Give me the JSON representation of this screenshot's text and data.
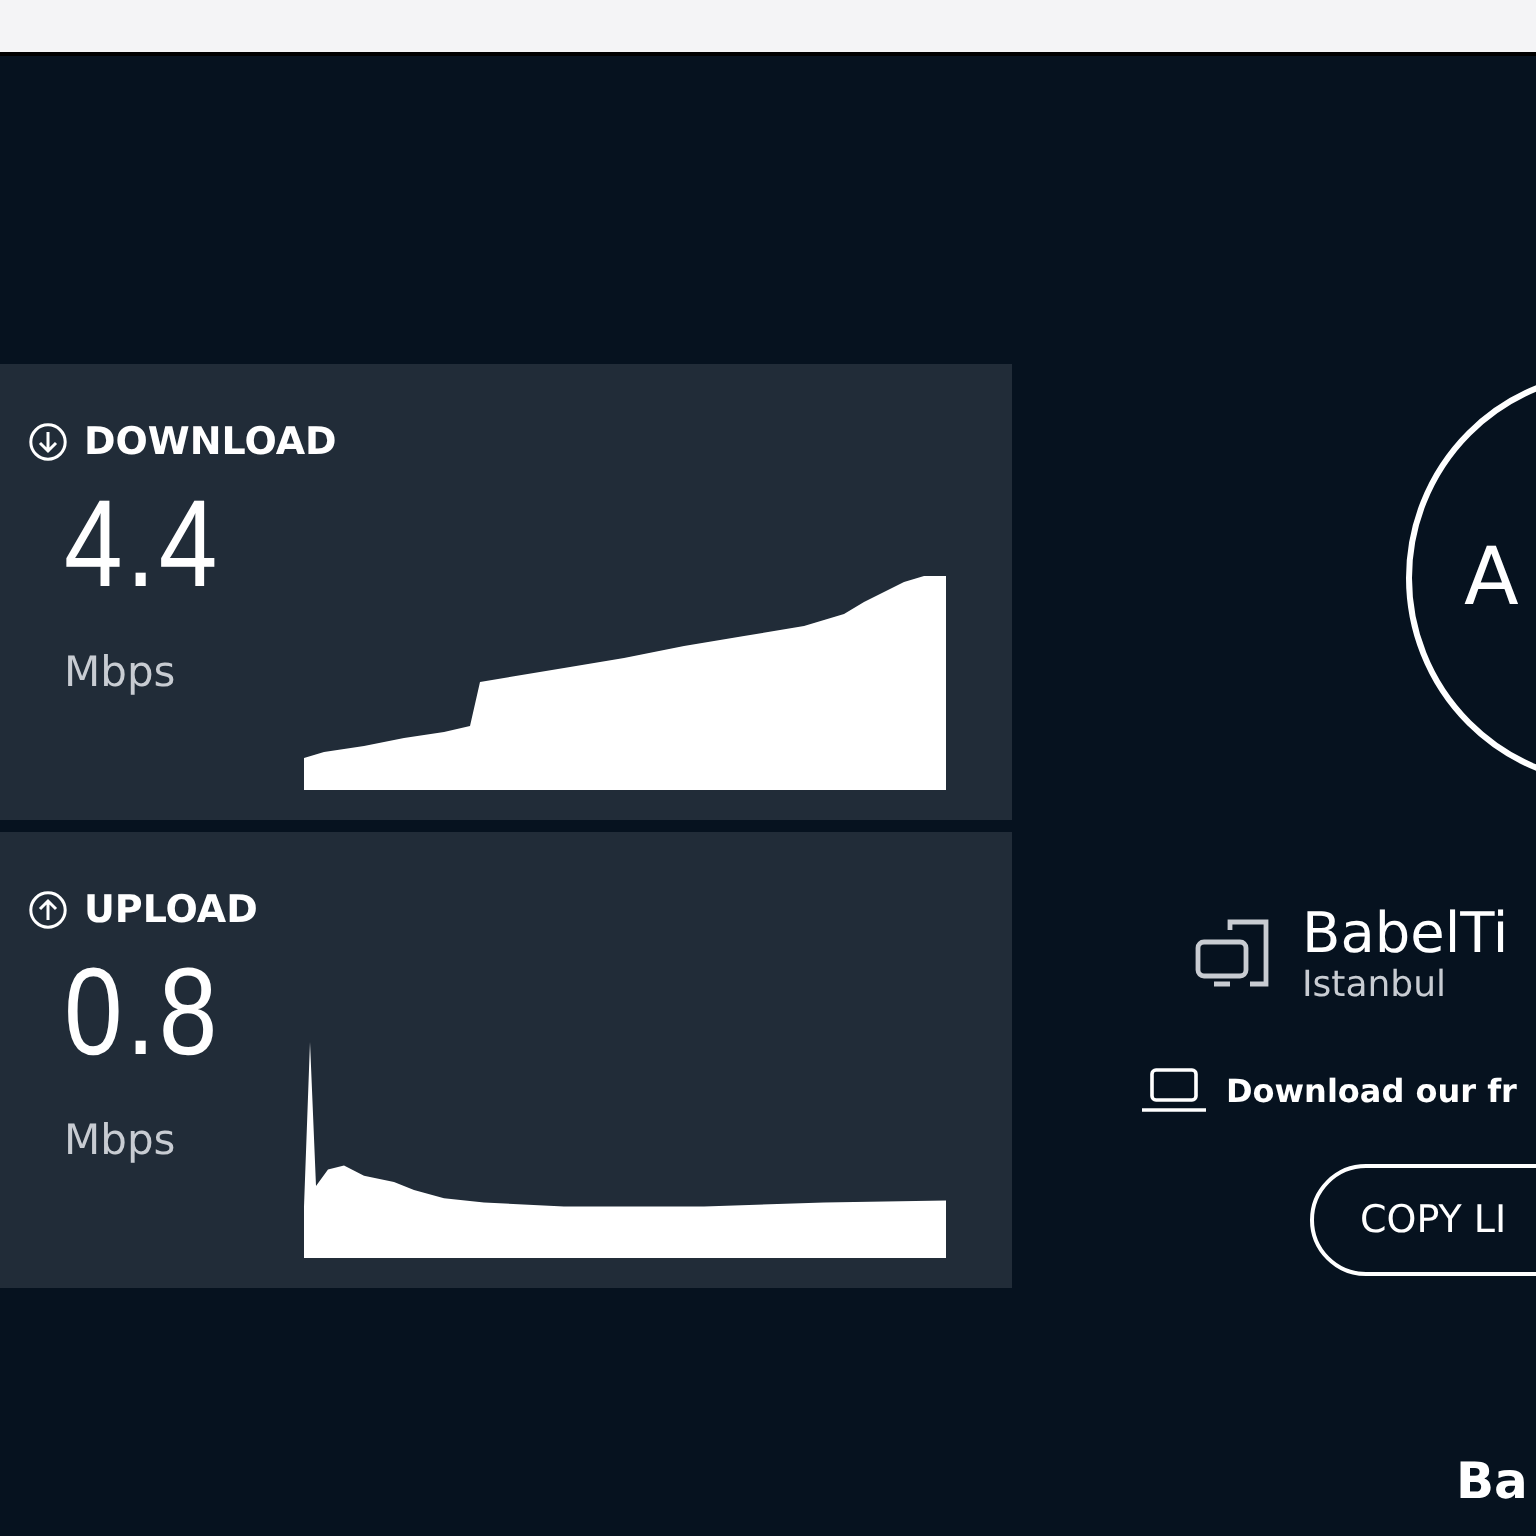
{
  "results": [
    {
      "kind": "download",
      "label": "DOWNLOAD",
      "value": "4.4",
      "unit": "Mbps"
    },
    {
      "kind": "upload",
      "label": "UPLOAD",
      "value": "0.8",
      "unit": "Mbps"
    }
  ],
  "gauge": {
    "label": "A"
  },
  "server": {
    "name": "BabelTi",
    "location": "Istanbul"
  },
  "app_link": "Download our fr",
  "copy_button": "COPY LI",
  "footer_heading": "Ba"
}
